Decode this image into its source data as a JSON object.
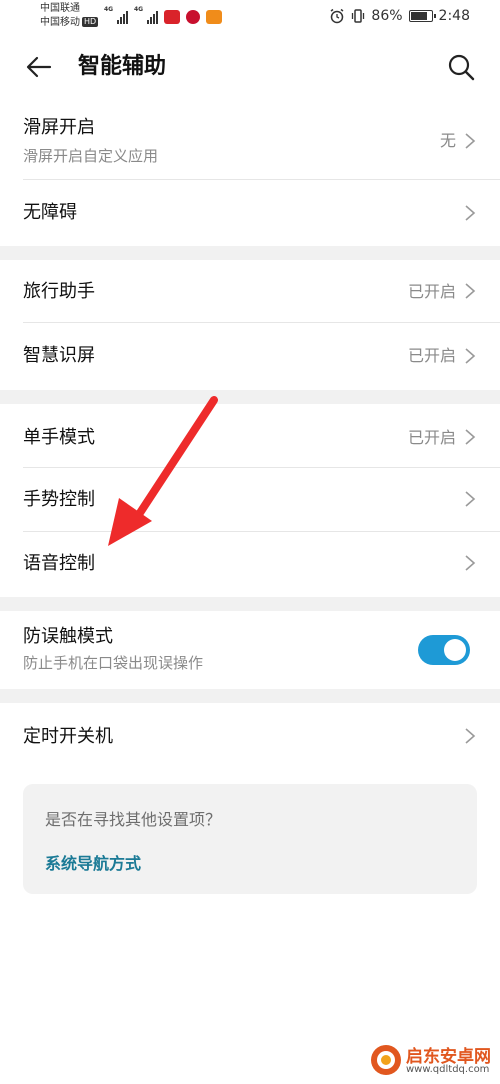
{
  "status_bar": {
    "carrier_1": "中国联通",
    "carrier_2": "中国移动",
    "hd": "HD",
    "net_1": "4G",
    "net_2": "4G",
    "battery_percent": "86%",
    "battery_level": 0.86,
    "time": "2:48"
  },
  "header": {
    "title": "智能辅助"
  },
  "groups": [
    {
      "rows": [
        {
          "title": "滑屏开启",
          "subtitle": "滑屏开启自定义应用",
          "value": "无"
        },
        {
          "title": "无障碍",
          "value": ""
        }
      ]
    },
    {
      "rows": [
        {
          "title": "旅行助手",
          "value": "已开启"
        },
        {
          "title": "智慧识屏",
          "value": "已开启"
        }
      ]
    },
    {
      "rows": [
        {
          "title": "单手模式",
          "value": "已开启"
        },
        {
          "title": "手势控制",
          "value": ""
        },
        {
          "title": "语音控制",
          "value": ""
        }
      ]
    },
    {
      "rows": [
        {
          "title": "防误触模式",
          "subtitle": "防止手机在口袋出现误操作",
          "toggle_on": true
        }
      ]
    },
    {
      "rows": [
        {
          "title": "定时开关机",
          "value": ""
        }
      ]
    }
  ],
  "suggestion": {
    "question": "是否在寻找其他设置项？",
    "link": "系统导航方式"
  },
  "watermark": {
    "name": "启东安卓网",
    "url": "www.qdltdq.com"
  },
  "colors": {
    "accent": "#1e9ad6",
    "link": "#1b7a96",
    "annotation_arrow": "#ee2b2b"
  }
}
